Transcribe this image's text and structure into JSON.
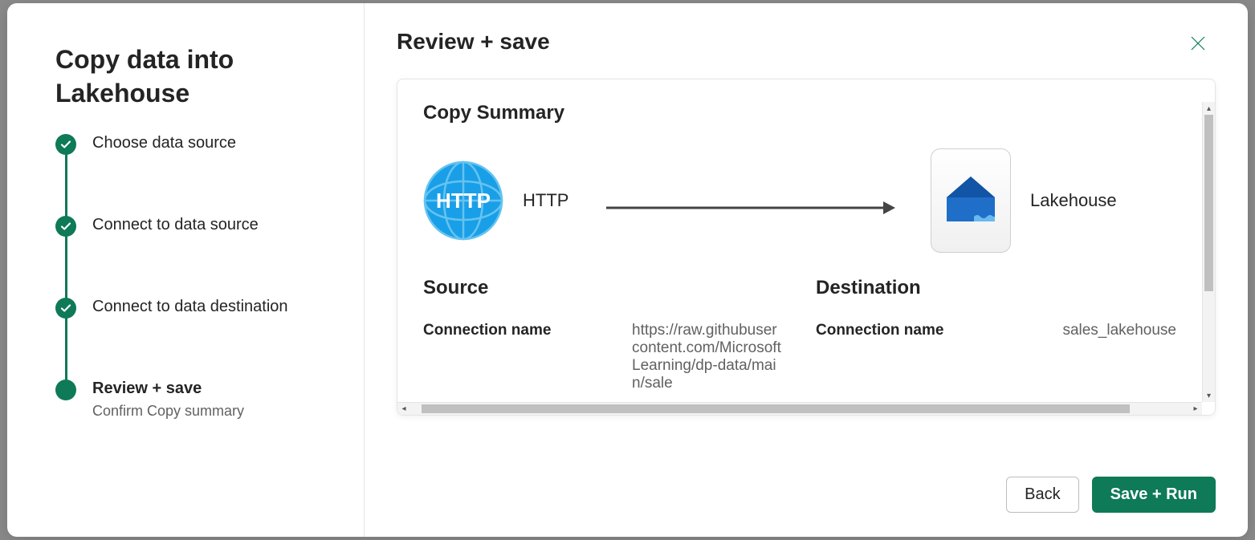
{
  "sidebar": {
    "title": "Copy data into Lakehouse",
    "steps": [
      {
        "label": "Choose data source",
        "done": true
      },
      {
        "label": "Connect to data source",
        "done": true
      },
      {
        "label": "Connect to data destination",
        "done": true
      },
      {
        "label": "Review + save",
        "active": true,
        "sub": "Confirm Copy summary"
      }
    ]
  },
  "main": {
    "title": "Review + save",
    "summary_title": "Copy Summary",
    "source_label": "HTTP",
    "dest_label": "Lakehouse",
    "source_section": "Source",
    "dest_section": "Destination",
    "source_conn_key": "Connection name",
    "source_conn_val": "https://raw.githubusercontent.com/MicrosoftLearning/dp-data/main/sale",
    "dest_conn_key": "Connection name",
    "dest_conn_val": "sales_lakehouse"
  },
  "footer": {
    "back": "Back",
    "save_run": "Save + Run"
  }
}
